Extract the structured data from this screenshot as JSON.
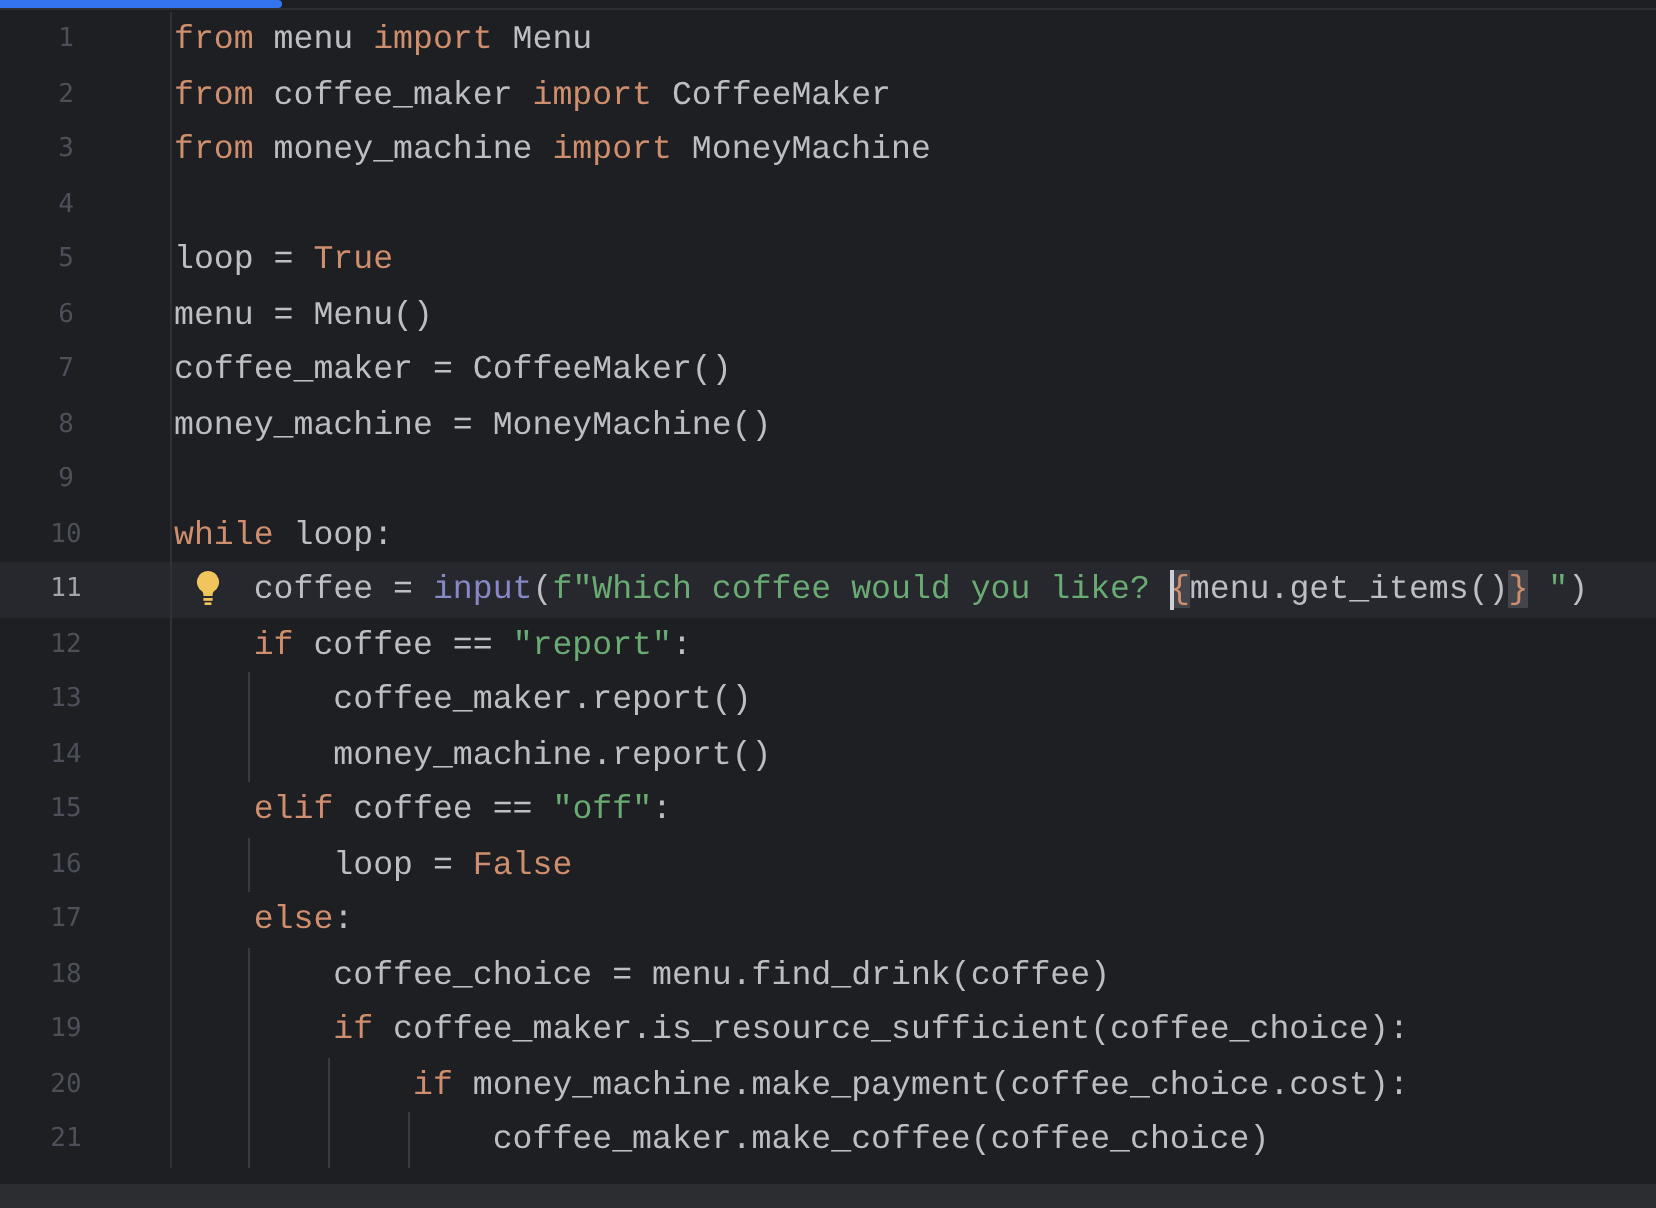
{
  "progress": {
    "level": 0.17
  },
  "lines": [
    {
      "number": "1",
      "selected": false,
      "bulb": false,
      "tokens": [
        {
          "kind": "keyword",
          "text": "from"
        },
        {
          "kind": "plain",
          "text": " menu "
        },
        {
          "kind": "keyword",
          "text": "import"
        },
        {
          "kind": "plain",
          "text": " Menu"
        }
      ]
    },
    {
      "number": "2",
      "selected": false,
      "bulb": false,
      "tokens": [
        {
          "kind": "keyword",
          "text": "from"
        },
        {
          "kind": "plain",
          "text": " coffee_maker "
        },
        {
          "kind": "keyword",
          "text": "import"
        },
        {
          "kind": "plain",
          "text": " CoffeeMaker"
        }
      ]
    },
    {
      "number": "3",
      "selected": false,
      "bulb": false,
      "tokens": [
        {
          "kind": "keyword",
          "text": "from"
        },
        {
          "kind": "plain",
          "text": " money_machine "
        },
        {
          "kind": "keyword",
          "text": "import"
        },
        {
          "kind": "plain",
          "text": " MoneyMachine"
        }
      ]
    },
    {
      "number": "4",
      "selected": false,
      "bulb": false
    },
    {
      "number": "5",
      "selected": false,
      "bulb": false,
      "tokens": [
        {
          "kind": "plain",
          "text": "loop = "
        },
        {
          "kind": "keyword",
          "text": "True"
        }
      ]
    },
    {
      "number": "6",
      "selected": false,
      "bulb": false,
      "tokens": [
        {
          "kind": "plain",
          "text": "menu = Menu()"
        }
      ]
    },
    {
      "number": "7",
      "selected": false,
      "bulb": false,
      "tokens": [
        {
          "kind": "plain",
          "text": "coffee_maker = CoffeeMaker()"
        }
      ]
    },
    {
      "number": "8",
      "selected": false,
      "bulb": false,
      "tokens": [
        {
          "kind": "plain",
          "text": "money_machine = MoneyMachine()"
        }
      ]
    },
    {
      "number": "9",
      "selected": false,
      "bulb": false
    },
    {
      "number": "10",
      "selected": false,
      "bulb": false,
      "tokens": [
        {
          "kind": "keyword",
          "text": "while"
        },
        {
          "kind": "plain",
          "text": " loop:"
        }
      ]
    },
    {
      "number": "11",
      "selected": true,
      "bulb": true,
      "tokens": [
        {
          "kind": "plain",
          "text": "    coffee = "
        },
        {
          "kind": "builtin",
          "text": "input"
        },
        {
          "kind": "plain",
          "text": "("
        },
        {
          "kind": "string",
          "text": "f\"Which coffee would you like? "
        },
        {
          "kind": "brace",
          "text": "{",
          "caret": true
        },
        {
          "kind": "plain",
          "text": "menu.get_items()"
        },
        {
          "kind": "brace",
          "text": "}"
        },
        {
          "kind": "string",
          "text": " \""
        },
        {
          "kind": "plain",
          "text": ")"
        }
      ]
    },
    {
      "number": "12",
      "selected": false,
      "bulb": false,
      "tokens": [
        {
          "kind": "keyword",
          "text": "    if"
        },
        {
          "kind": "plain",
          "text": " coffee == "
        },
        {
          "kind": "string",
          "text": "\"report\""
        },
        {
          "kind": "plain",
          "text": ":"
        }
      ]
    },
    {
      "number": "13",
      "selected": false,
      "bulb": false,
      "tokens": [
        {
          "kind": "plain",
          "text": "        coffee_maker.report()"
        }
      ]
    },
    {
      "number": "14",
      "selected": false,
      "bulb": false,
      "tokens": [
        {
          "kind": "plain",
          "text": "        money_machine.report()"
        }
      ]
    },
    {
      "number": "15",
      "selected": false,
      "bulb": false,
      "tokens": [
        {
          "kind": "keyword",
          "text": "    elif"
        },
        {
          "kind": "plain",
          "text": " coffee == "
        },
        {
          "kind": "string",
          "text": "\"off\""
        },
        {
          "kind": "plain",
          "text": ":"
        }
      ]
    },
    {
      "number": "16",
      "selected": false,
      "bulb": false,
      "tokens": [
        {
          "kind": "plain",
          "text": "        loop = "
        },
        {
          "kind": "keyword",
          "text": "False"
        }
      ]
    },
    {
      "number": "17",
      "selected": false,
      "bulb": false,
      "tokens": [
        {
          "kind": "keyword",
          "text": "    else"
        },
        {
          "kind": "plain",
          "text": ":"
        }
      ]
    },
    {
      "number": "18",
      "selected": false,
      "bulb": false,
      "tokens": [
        {
          "kind": "plain",
          "text": "        coffee_choice = menu.find_drink(coffee)"
        }
      ]
    },
    {
      "number": "19",
      "selected": false,
      "bulb": false,
      "tokens": [
        {
          "kind": "keyword",
          "text": "        if"
        },
        {
          "kind": "plain",
          "text": " coffee_maker.is_resource_sufficient(coffee_choice):"
        }
      ]
    },
    {
      "number": "20",
      "selected": false,
      "bulb": false,
      "tokens": [
        {
          "kind": "keyword",
          "text": "            if"
        },
        {
          "kind": "plain",
          "text": " money_machine.make_payment(coffee_choice.cost):"
        }
      ]
    },
    {
      "number": "21",
      "selected": false,
      "bulb": false,
      "tokens": [
        {
          "kind": "plain",
          "text": "                coffee_maker.make_coffee(coffee_choice)"
        }
      ]
    }
  ]
}
